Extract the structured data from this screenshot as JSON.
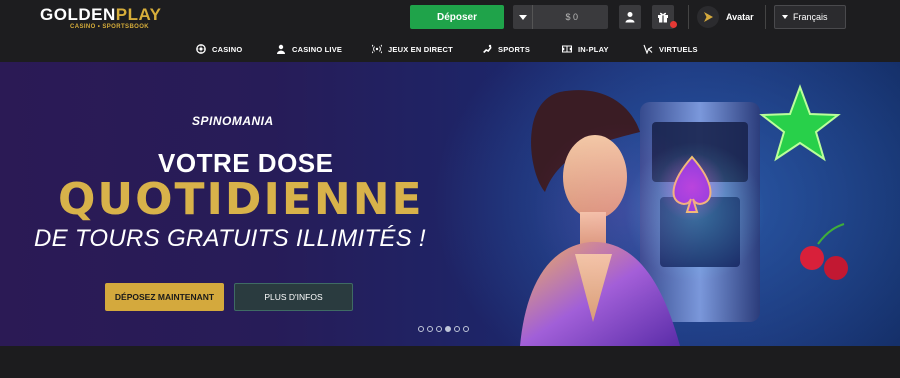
{
  "brand": {
    "logo_part1": "GOLDEN",
    "logo_part2": "PLAY",
    "logo_tagline": "CASINO • SPORTSBOOK"
  },
  "header": {
    "deposit_label": "Déposer",
    "balance": "$ 0",
    "avatar_label": "Avatar",
    "language": "Français"
  },
  "nav": {
    "items": [
      {
        "label": "CASINO",
        "icon": "casino-chip-icon"
      },
      {
        "label": "CASINO LIVE",
        "icon": "live-dealer-icon"
      },
      {
        "label": "JEUX EN DIRECT",
        "icon": "broadcast-icon"
      },
      {
        "label": "SPORTS",
        "icon": "sports-icon"
      },
      {
        "label": "IN-PLAY",
        "icon": "in-play-icon"
      },
      {
        "label": "VIRTUELS",
        "icon": "virtual-icon"
      }
    ]
  },
  "hero": {
    "tag": "SPINOMANIA",
    "line1": "VOTRE DOSE",
    "line2": "QUOTIDIENNE",
    "line3": "DE TOURS GRATUITS ILLIMITÉS !",
    "primary_cta": "DÉPOSEZ MAINTENANT",
    "secondary_cta": "PLUS D'INFOS",
    "carousel": {
      "total_slides": 6,
      "active_slide": 4
    }
  },
  "colors": {
    "accent_gold": "#d4a93d",
    "deposit_green": "#1fa34a",
    "background": "#1d1d1f"
  }
}
